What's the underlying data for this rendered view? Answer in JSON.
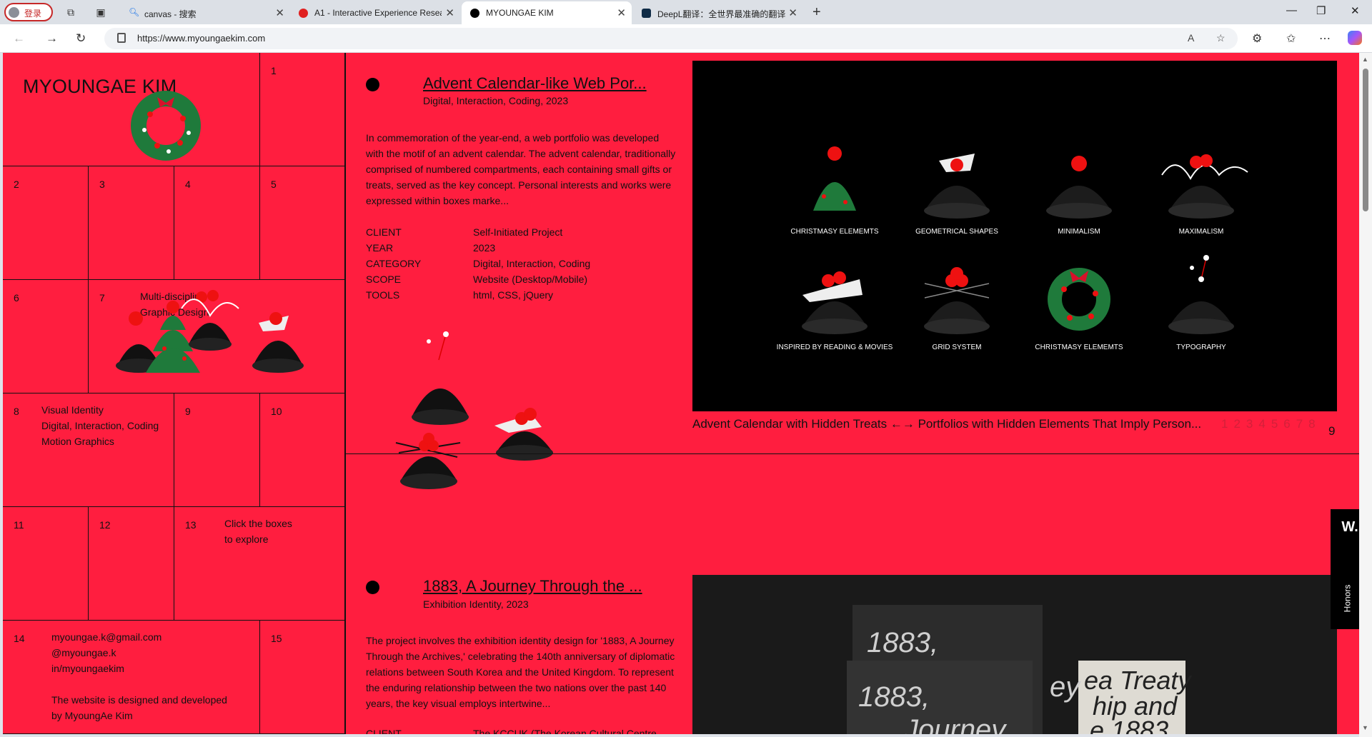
{
  "browser": {
    "profile_label": "登录",
    "tabs": [
      {
        "title": "canvas - 搜索"
      },
      {
        "title": "A1 - Interactive Experience Resea"
      },
      {
        "title": "MYOUNGAE KIM"
      },
      {
        "title": "DeepL翻译：全世界最准确的翻译"
      }
    ],
    "url": "https://www.myoungaekim.com"
  },
  "grid": {
    "brand": "MYOUNGAE KIM",
    "cells": {
      "n1": "1",
      "n2": "2",
      "n3": "3",
      "n4": "4",
      "n5": "5",
      "n6": "6",
      "n7": "7",
      "n8": "8",
      "n9": "9",
      "n10": "10",
      "n11": "11",
      "n12": "12",
      "n13": "13",
      "n14": "14",
      "n15": "15"
    },
    "cell7_text": "Multi-disciplin\nGraphic Design",
    "cell8_text": "Visual Identity\nDigital, Interaction, Coding\nMotion Graphics",
    "cell13_text": "Click the boxes\nto explore",
    "cell14_contact": "myoungae.k@gmail.com\n@myoungae.k\nin/myoungaekim",
    "cell14_credit": "The website is designed and developed\nby MyoungAe Kim"
  },
  "project1": {
    "title": "Advent Calendar-like Web Por...",
    "subtitle": "Digital, Interaction, Coding, 2023",
    "description": "In commemoration of the year-end, a web portfolio was developed with the motif of an advent calendar. The advent calendar, traditionally comprised of numbered compartments, each containing small gifts or treats, served as the key concept. Personal interests and works were expressed within boxes marke...",
    "meta": [
      {
        "k": "CLIENT",
        "v": "Self-Initiated Project"
      },
      {
        "k": "YEAR",
        "v": "2023"
      },
      {
        "k": "CATEGORY",
        "v": "Digital, Interaction, Coding"
      },
      {
        "k": "SCOPE",
        "v": "Website (Desktop/Mobile)"
      },
      {
        "k": "TOOLS",
        "v": "html, CSS, jQuery"
      }
    ],
    "preview_labels": [
      "CHRISTMASY ELEMEMTS",
      "GEOMETRICAL SHAPES",
      "MINIMALISM",
      "MAXIMALISM",
      "INSPIRED BY READING  & MOVIES",
      "GRID SYSTEM",
      "CHRISTMASY ELEMEMTS",
      "TYPOGRAPHY"
    ],
    "caption": "Advent Calendar with Hidden Treats  ←→  Portfolios with Hidden Elements That Imply Person...",
    "pager": "12345678",
    "pager_current": "9"
  },
  "project2": {
    "title": "1883, A Journey Through the ...",
    "subtitle": "Exhibition Identity, 2023",
    "description": "The project involves the exhibition identity design for '1883, A Journey Through the Archives,' celebrating the 140th anniversary of diplomatic relations between South Korea and the United Kingdom. To represent the enduring relationship between the two nations over the past 140 years, the key visual employs intertwine...",
    "meta_first": {
      "k": "CLIENT",
      "v": "The KCCUK (The Korean Cultural Centre..."
    },
    "poster_text": {
      "big1": "1883,",
      "big2": "1883,",
      "journey": "Journey",
      "treaty1": "ea Treaty",
      "treaty2": "hip and",
      "treaty3": "e 1883",
      "ey": "ey"
    }
  },
  "badge": {
    "logo": "W.",
    "label": "Honors"
  },
  "colors": {
    "page_bg": "#ff1e3f",
    "preview_bg": "#000000"
  }
}
